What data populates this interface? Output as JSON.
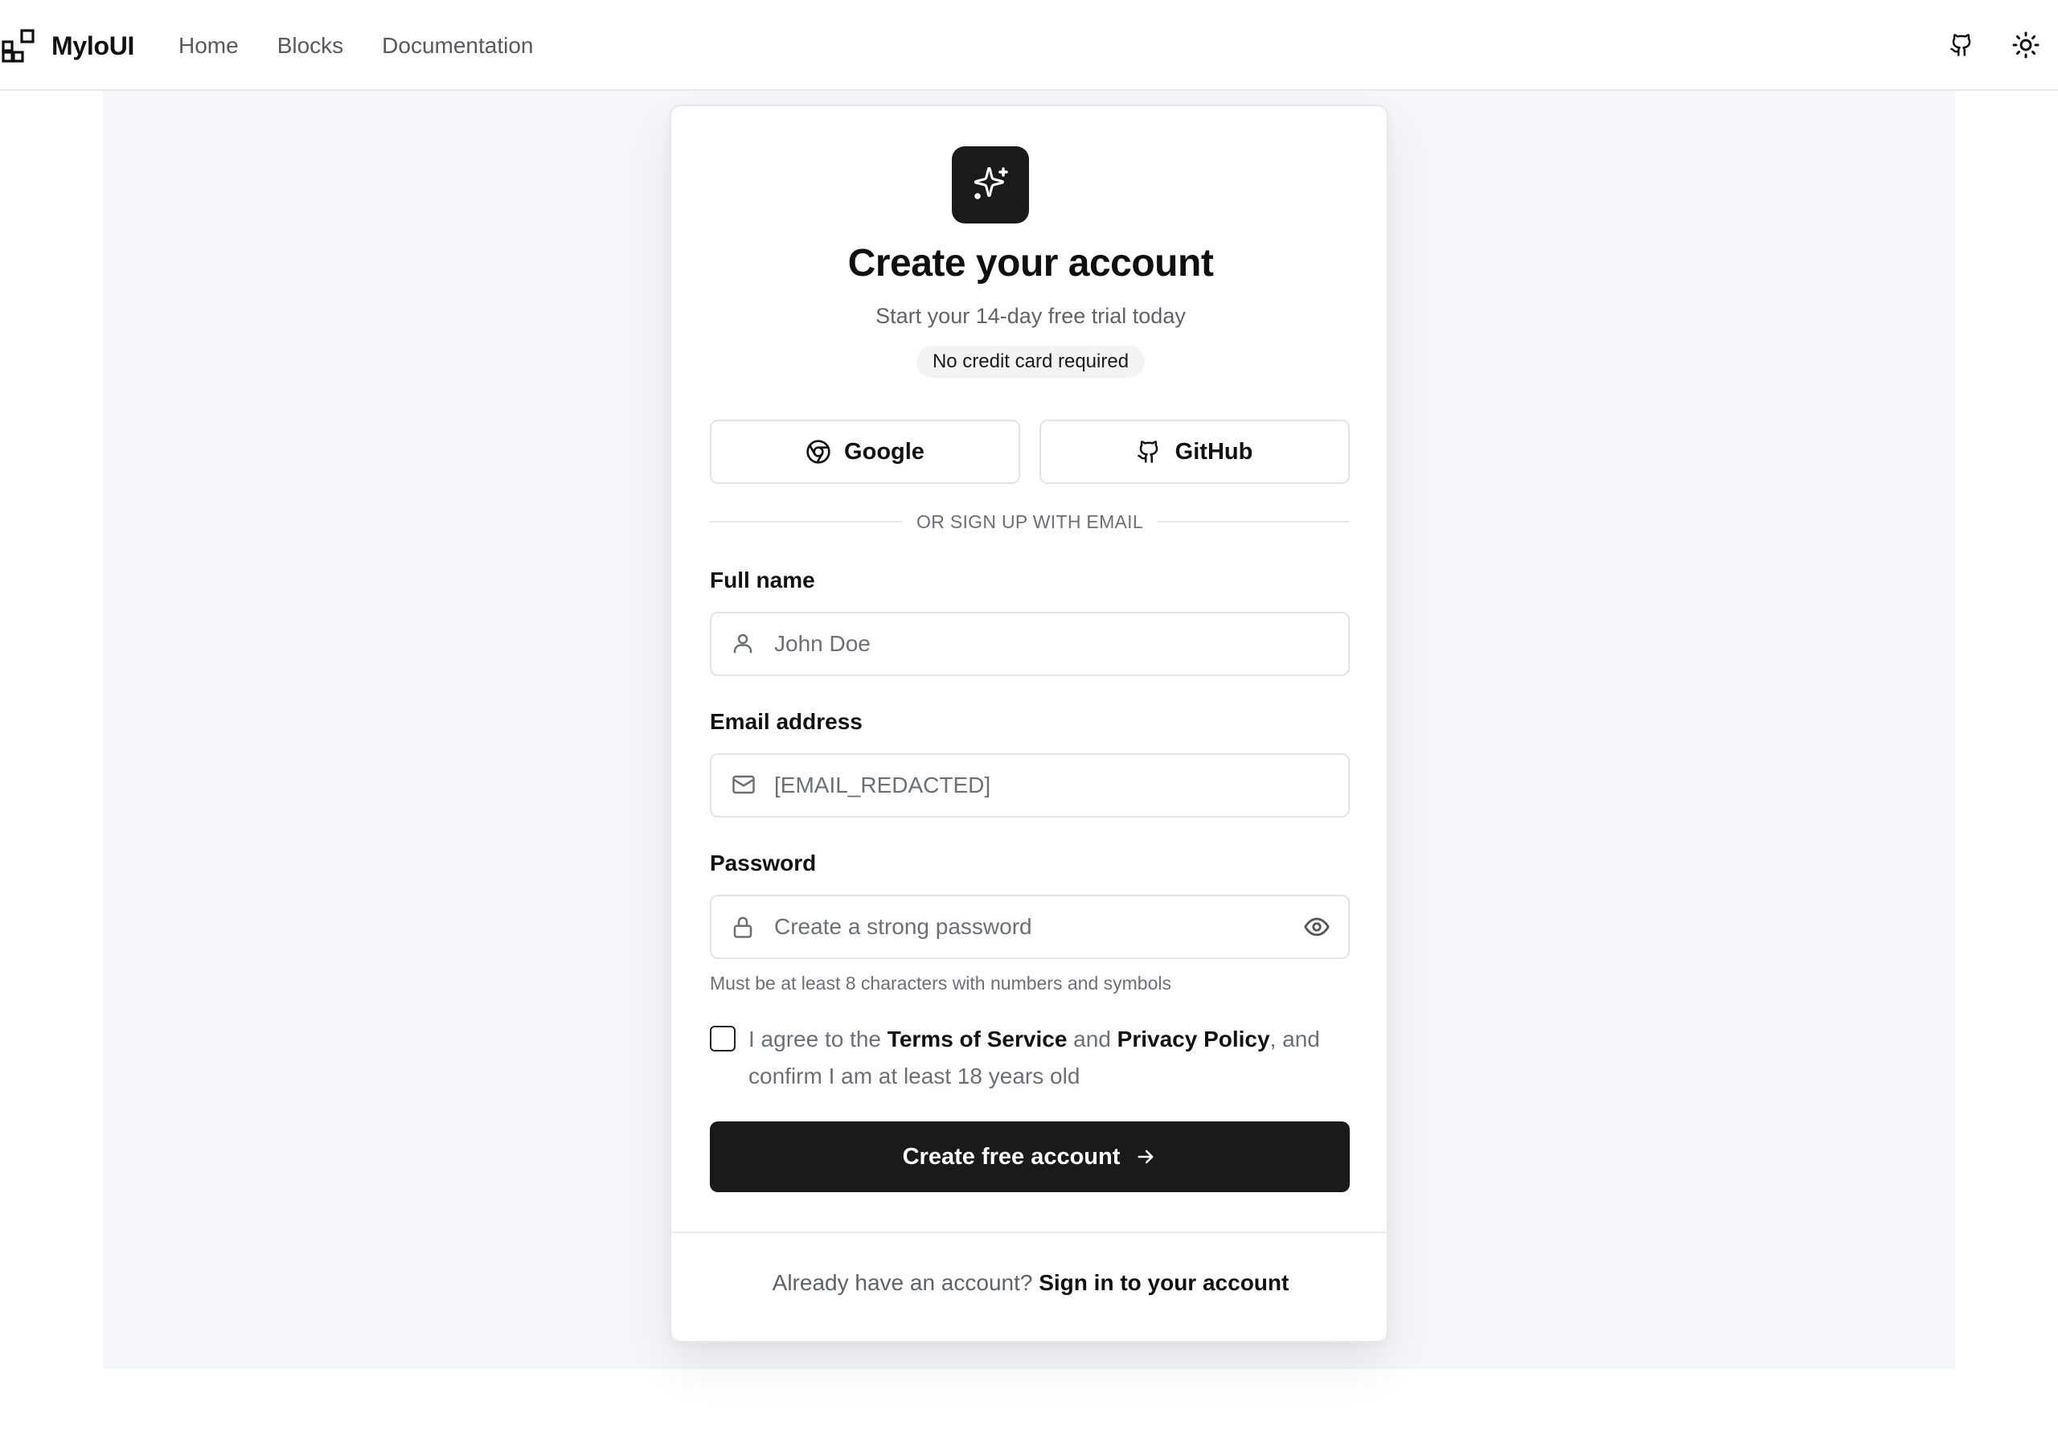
{
  "app": {
    "brand": "MyloUI",
    "nav": [
      "Home",
      "Blocks",
      "Documentation"
    ]
  },
  "card": {
    "title": "Create your account",
    "subtitle": "Start your 14-day free trial today",
    "badge": "No credit card required",
    "social": {
      "google": "Google",
      "github": "GitHub"
    },
    "divider": "OR SIGN UP WITH EMAIL",
    "fields": {
      "name": {
        "label": "Full name",
        "placeholder": "John Doe"
      },
      "email": {
        "label": "Email address",
        "placeholder": "[EMAIL_REDACTED]"
      },
      "password": {
        "label": "Password",
        "placeholder": "Create a strong password"
      }
    },
    "password_hint": "Must be at least 8 characters with numbers and symbols",
    "agree": {
      "pre": "I agree to the ",
      "terms": "Terms of Service",
      "mid": " and ",
      "privacy": "Privacy Policy",
      "post": ", and confirm I am at least 18 years old"
    },
    "submit": "Create free account",
    "footer": {
      "text": "Already have an account? ",
      "link": "Sign in to your account"
    }
  }
}
